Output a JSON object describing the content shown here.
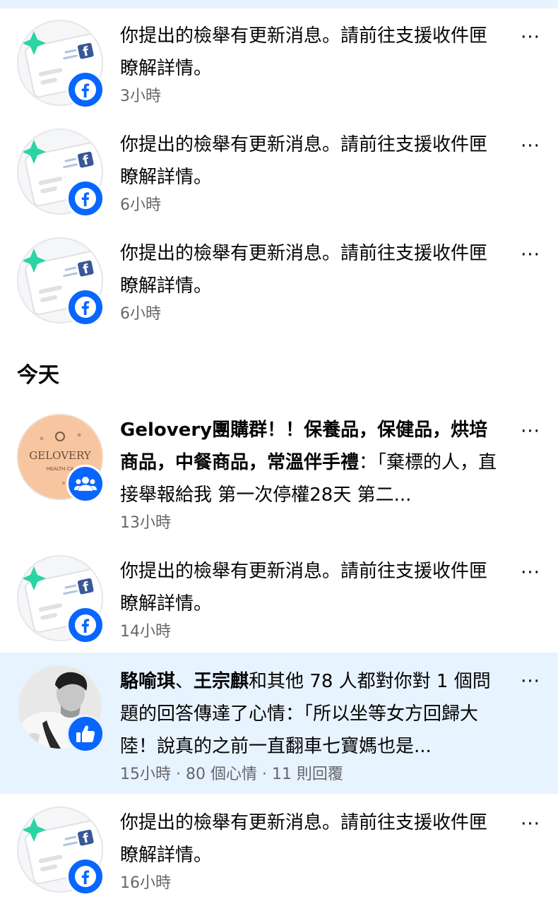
{
  "report_message": "你提出的檢舉有更新消息。請前往支援收件匣瞭解詳情。",
  "section_today": "今天",
  "notifications": [
    {
      "time": "3小時"
    },
    {
      "time": "6小時"
    },
    {
      "time": "6小時"
    },
    {
      "group_name": "Gelovery團購群！！保養品，保健品，烘培商品，中餐商品，常溫伴手禮",
      "quote": "：「棄標的人，直接舉報給我 第一次停權28天 第二...",
      "time": "13小時",
      "avatar_text": "GELOVERY",
      "avatar_subtext": "HEALTH CA"
    },
    {
      "time": "14小時"
    },
    {
      "name1": "駱喻琪",
      "separator": "、",
      "name2": "王宗麒",
      "rest": "和其他 78 人都對你對 1 個問題的回答傳達了心情：「所以坐等女方回歸大陸！說真的之前一直翻車七寶媽也是...",
      "meta": "15小時 · 80 個心情 · 11 則回覆"
    },
    {
      "time": "16小時"
    }
  ],
  "more_label": "···",
  "colors": {
    "brand": "#0866ff",
    "highlight": "#e7f3ff",
    "meta": "#65676b"
  }
}
